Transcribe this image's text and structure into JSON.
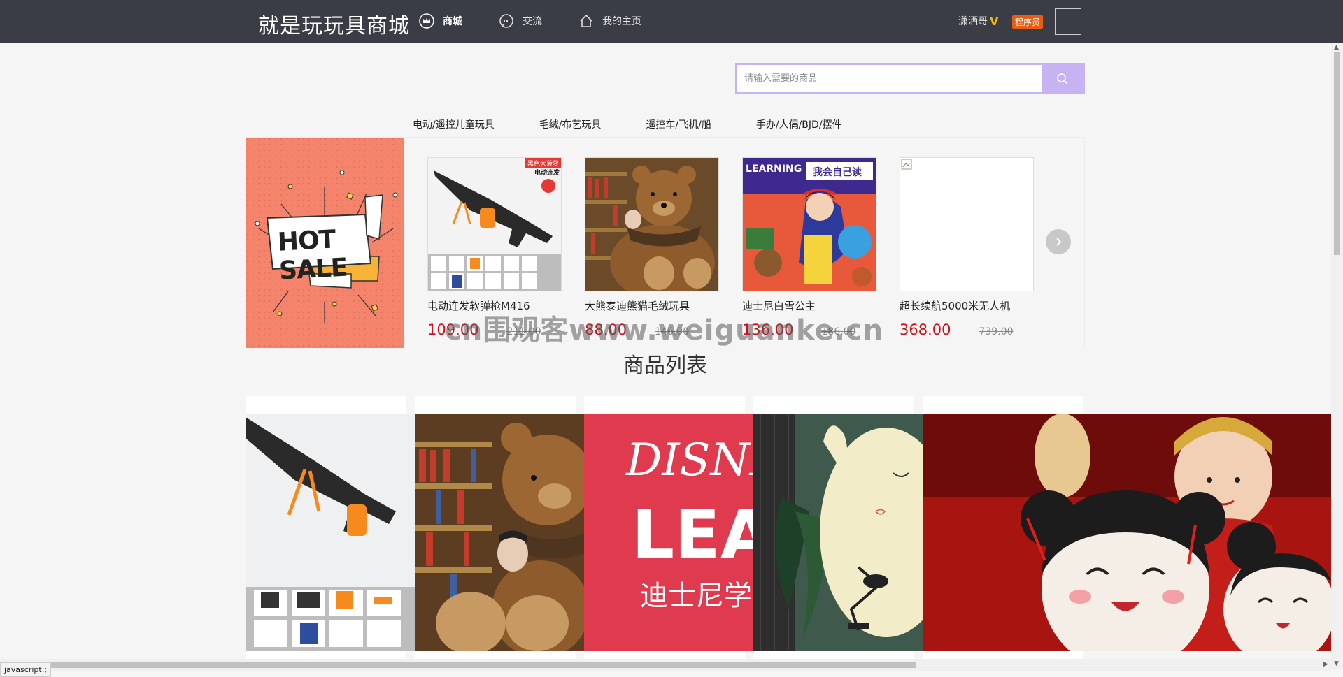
{
  "header": {
    "logo": "就是玩玩具商城",
    "nav": [
      {
        "label": "商城",
        "icon": "crown-icon"
      },
      {
        "label": "交流",
        "icon": "chat-icon"
      },
      {
        "label": "我的主页",
        "icon": "home-icon"
      }
    ],
    "username": "潇洒哥",
    "verified_mark": "V",
    "role_badge": "程序员"
  },
  "search": {
    "placeholder": "请输入需要的商品",
    "button_icon": "search-icon"
  },
  "categories": [
    "电动/遥控儿童玩具",
    "毛绒/布艺玩具",
    "遥控车/飞机/船",
    "手办/人偶/BJD/摆件"
  ],
  "hot_banner": {
    "text": "HOT SALE"
  },
  "hot_items": [
    {
      "name": "电动连发软弹枪M416",
      "price": "109.00",
      "old_price": "211.00",
      "badge": "黑色大菠萝",
      "badge2": "电动连发"
    },
    {
      "name": "大熊泰迪熊猫毛绒玩具",
      "price": "88.00",
      "old_price": "146.00"
    },
    {
      "name": "迪士尼白雪公主",
      "price": "136.00",
      "old_price": "186.00",
      "cover_brand": "LEARNING",
      "cover_title": "我会自己读"
    },
    {
      "name": "超长续航5000米无人机",
      "price": "368.00",
      "old_price": "739.00"
    }
  ],
  "watermark": "cn围观客www.weiguanke.cn",
  "section_title": "商品列表",
  "product_list": [
    {
      "alt": "电动连发软弹枪M416"
    },
    {
      "alt": "大熊泰迪熊猫毛绒玩具"
    },
    {
      "alt": "迪士尼白雪公主",
      "text1": "DISNE",
      "text2": "LEA",
      "text3": "迪士尼学"
    },
    {
      "alt": "毛绒玩偶"
    },
    {
      "alt": "中国娃娃"
    }
  ],
  "status_bar": "javascript:;",
  "colors": {
    "header_bg": "#3a3d45",
    "accent": "#c8b3f2",
    "price": "#d0111b",
    "role_badge": "#e85d10"
  }
}
